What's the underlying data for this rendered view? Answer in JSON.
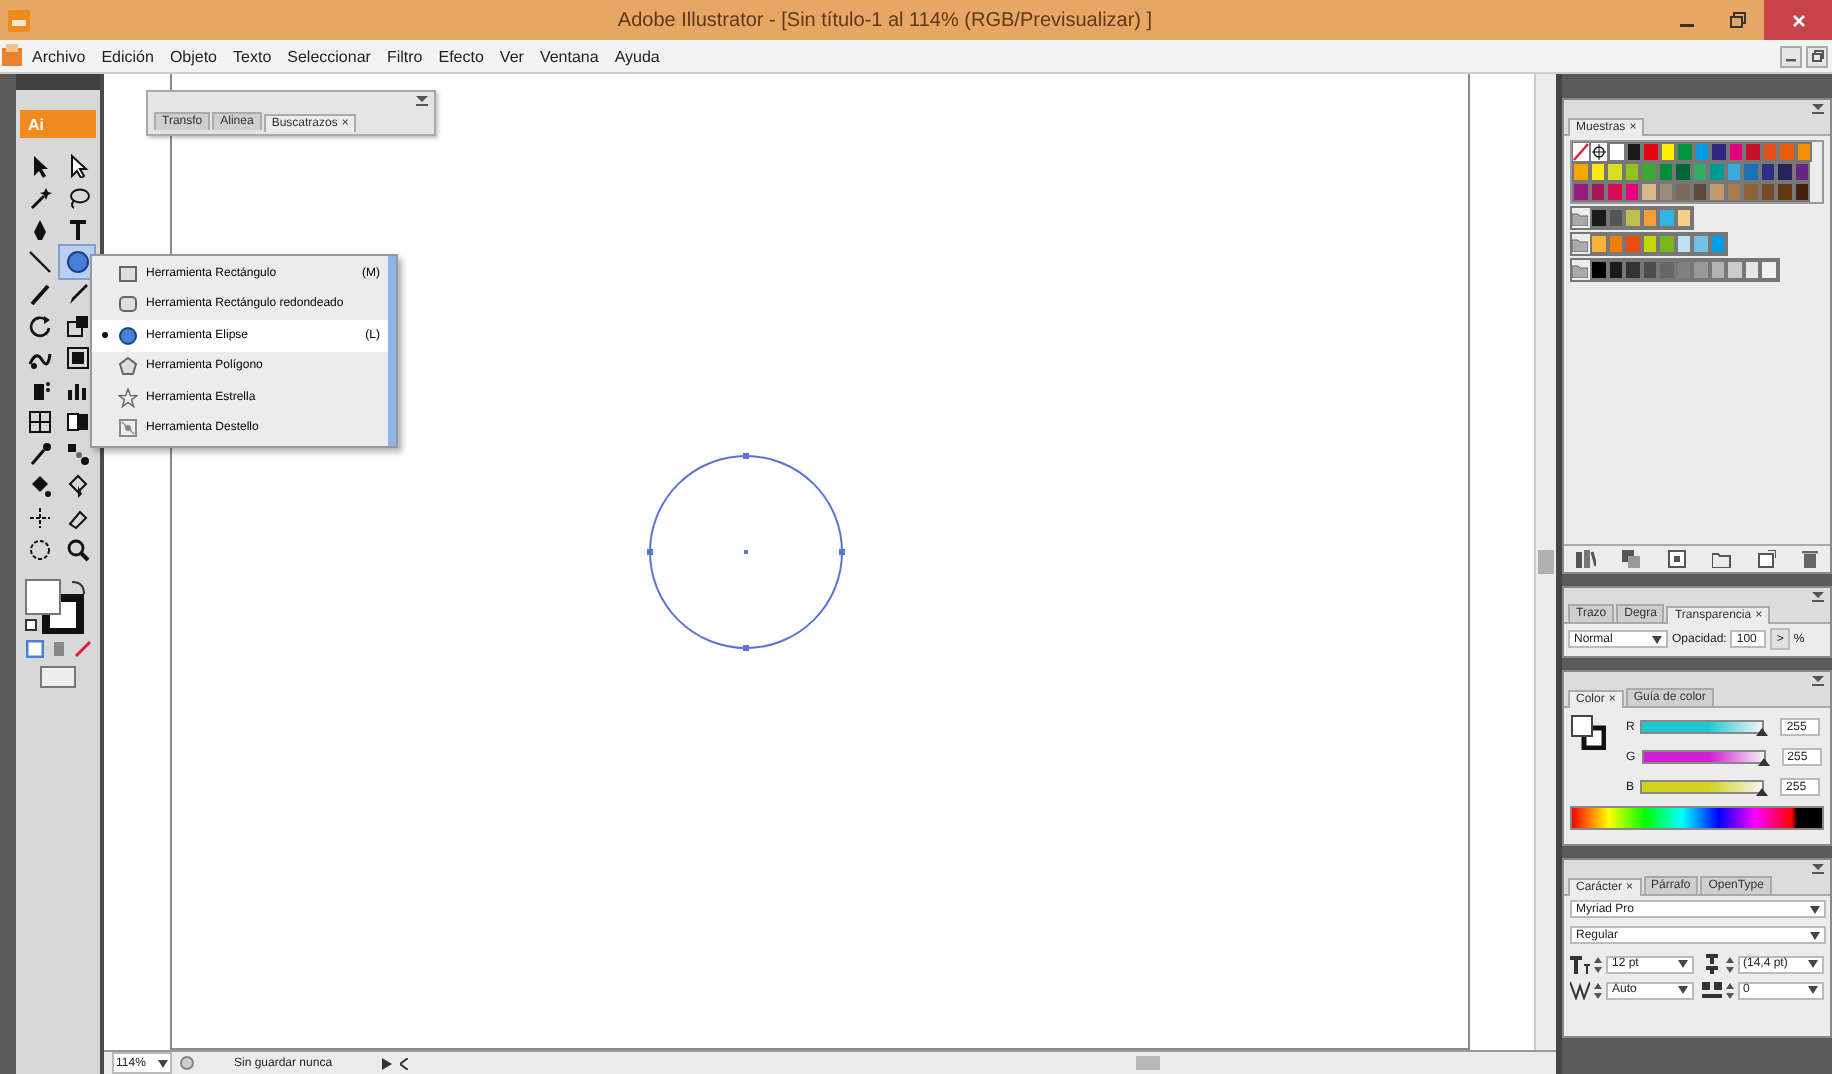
{
  "window": {
    "title": "Adobe Illustrator - [Sin título-1 al 114% (RGB/Previsualizar) ]"
  },
  "menu": [
    "Archivo",
    "Edición",
    "Objeto",
    "Texto",
    "Seleccionar",
    "Filtro",
    "Efecto",
    "Ver",
    "Ventana",
    "Ayuda"
  ],
  "toolbox": {
    "logo": "Ai",
    "tools": [
      {
        "selected": false
      },
      {
        "selected": false
      },
      {
        "selected": false
      },
      {
        "selected": false
      },
      {
        "selected": false
      },
      {
        "selected": false
      },
      {
        "selected": false
      },
      {
        "selected": true
      },
      {
        "selected": false
      },
      {
        "selected": false
      },
      {
        "selected": false
      },
      {
        "selected": false
      },
      {
        "selected": false
      },
      {
        "selected": false
      },
      {
        "selected": false
      },
      {
        "selected": false
      },
      {
        "selected": false
      },
      {
        "selected": false
      },
      {
        "selected": false
      },
      {
        "selected": false
      },
      {
        "selected": false
      },
      {
        "selected": false
      },
      {
        "selected": false
      },
      {
        "selected": false
      },
      {
        "selected": false
      },
      {
        "selected": false
      }
    ]
  },
  "flyout": {
    "items": [
      {
        "label": "Herramienta Rectángulo",
        "shortcut": "(M)",
        "selected": false
      },
      {
        "label": "Herramienta Rectángulo redondeado",
        "selected": false
      },
      {
        "label": "Herramienta Elipse",
        "shortcut": "(L)",
        "selected": true
      },
      {
        "label": "Herramienta Polígono",
        "selected": false
      },
      {
        "label": "Herramienta Estrella",
        "selected": false
      },
      {
        "label": "Herramienta Destello",
        "selected": false
      }
    ]
  },
  "floating_panel": {
    "tabs": [
      {
        "label": "Transfo",
        "selected": false
      },
      {
        "label": "Alinea",
        "selected": false
      },
      {
        "label": "Buscatrazos",
        "close": "×",
        "selected": true
      }
    ]
  },
  "status_bar": {
    "zoom": "114%",
    "state": "Sin guardar nunca"
  },
  "swatches_panel": {
    "tabs": [
      {
        "label": "Muestras",
        "close": "×",
        "selected": true
      }
    ],
    "groups": [
      {
        "folder": false,
        "swatches": [
          {
            "kind": "none"
          },
          {
            "kind": "registration"
          },
          {
            "kind": "color",
            "color": "#ffffff"
          },
          {
            "kind": "color",
            "color": "#1a1a1a"
          },
          {
            "kind": "color",
            "color": "#e30613"
          },
          {
            "kind": "color",
            "color": "#ffed00"
          },
          {
            "kind": "color",
            "color": "#009640"
          },
          {
            "kind": "color",
            "color": "#009fe3"
          },
          {
            "kind": "color",
            "color": "#312783"
          },
          {
            "kind": "color",
            "color": "#e6007e"
          },
          {
            "kind": "color",
            "color": "#c8102e"
          },
          {
            "kind": "color",
            "color": "#e94e1b"
          },
          {
            "kind": "color",
            "color": "#ea5b0c"
          },
          {
            "kind": "color",
            "color": "#f39200"
          },
          {
            "kind": "color",
            "color": "#f7a600"
          },
          {
            "kind": "color",
            "color": "#fcea10"
          },
          {
            "kind": "color",
            "color": "#d9e021"
          },
          {
            "kind": "color",
            "color": "#95c11f"
          },
          {
            "kind": "color",
            "color": "#3aaa35"
          },
          {
            "kind": "color",
            "color": "#008d36"
          },
          {
            "kind": "color",
            "color": "#006633"
          },
          {
            "kind": "color",
            "color": "#2fac66"
          },
          {
            "kind": "color",
            "color": "#009a93"
          },
          {
            "kind": "color",
            "color": "#36a9e1"
          },
          {
            "kind": "color",
            "color": "#1d71b8"
          },
          {
            "kind": "color",
            "color": "#2d2e83"
          },
          {
            "kind": "color",
            "color": "#29235c"
          },
          {
            "kind": "color",
            "color": "#662483"
          },
          {
            "kind": "color",
            "color": "#951b81"
          },
          {
            "kind": "color",
            "color": "#a3195b"
          },
          {
            "kind": "color",
            "color": "#d60b52"
          },
          {
            "kind": "color",
            "color": "#e5007d"
          },
          {
            "kind": "color",
            "color": "#d8b98c"
          },
          {
            "kind": "color",
            "color": "#a08b7a"
          },
          {
            "kind": "color",
            "color": "#7c6a5b"
          },
          {
            "kind": "color",
            "color": "#5b4b3f"
          },
          {
            "kind": "color",
            "color": "#c49a6c"
          },
          {
            "kind": "color",
            "color": "#a67c52"
          },
          {
            "kind": "color",
            "color": "#8c6239"
          },
          {
            "kind": "color",
            "color": "#754c24"
          },
          {
            "kind": "color",
            "color": "#603913"
          },
          {
            "kind": "color",
            "color": "#42210b"
          }
        ]
      },
      {
        "folder": true,
        "swatches": [
          {
            "kind": "color",
            "color": "#1a1a1a"
          },
          {
            "kind": "color",
            "color": "#555555"
          },
          {
            "kind": "color",
            "color": "#c0c050"
          },
          {
            "kind": "color",
            "color": "#f39c3a"
          },
          {
            "kind": "color",
            "color": "#2eb5e3"
          },
          {
            "kind": "color",
            "color": "#f7d08a"
          }
        ]
      },
      {
        "folder": true,
        "swatches": [
          {
            "kind": "color",
            "color": "#f9b233"
          },
          {
            "kind": "color",
            "color": "#ef7d00"
          },
          {
            "kind": "color",
            "color": "#e84e0f"
          },
          {
            "kind": "color",
            "color": "#c8d400"
          },
          {
            "kind": "color",
            "color": "#7ab51d"
          },
          {
            "kind": "color",
            "color": "#bde3f1"
          },
          {
            "kind": "color",
            "color": "#6ec1e4"
          },
          {
            "kind": "color",
            "color": "#009fe3"
          }
        ]
      },
      {
        "folder": true,
        "swatches": [
          {
            "kind": "color",
            "color": "#000000"
          },
          {
            "kind": "color",
            "color": "#1a1a1a"
          },
          {
            "kind": "color",
            "color": "#333333"
          },
          {
            "kind": "color",
            "color": "#4d4d4d"
          },
          {
            "kind": "color",
            "color": "#666666"
          },
          {
            "kind": "color",
            "color": "#808080"
          },
          {
            "kind": "color",
            "color": "#999999"
          },
          {
            "kind": "color",
            "color": "#b3b3b3"
          },
          {
            "kind": "color",
            "color": "#cccccc"
          },
          {
            "kind": "color",
            "color": "#e6e6e6"
          },
          {
            "kind": "color",
            "color": "#f2f2f2"
          }
        ]
      }
    ]
  },
  "appearance_panel": {
    "tabs": [
      {
        "label": "Trazo",
        "selected": false
      },
      {
        "label": "Degra",
        "selected": false
      },
      {
        "label": "Transparencia",
        "close": "×",
        "selected": true
      }
    ],
    "blend_mode": "Normal",
    "opacity_label": "Opacidad:",
    "opacity": "100",
    "opacity_button": ">",
    "opacity_unit": "%"
  },
  "color_panel": {
    "tabs": [
      {
        "label": "Color",
        "close": "×",
        "selected": true
      },
      {
        "label": "Guía de color",
        "selected": false
      }
    ],
    "channels": [
      {
        "name": "R",
        "level": 1,
        "value": "255",
        "color": "#1ec8d2"
      },
      {
        "name": "G",
        "level": 1,
        "value": "255",
        "color": "#d21ed2"
      },
      {
        "name": "B",
        "level": 1,
        "value": "255",
        "color": "#d2d21e"
      }
    ]
  },
  "character_panel": {
    "tabs": [
      {
        "label": "Carácter",
        "close": "×",
        "selected": true
      },
      {
        "label": "Párrafo",
        "selected": false
      },
      {
        "label": "OpenType",
        "selected": false
      }
    ],
    "font": "Myriad Pro",
    "style": "Regular",
    "size": "12 pt",
    "leading": "(14,4 pt)",
    "kerning": "Auto",
    "tracking": "0"
  }
}
